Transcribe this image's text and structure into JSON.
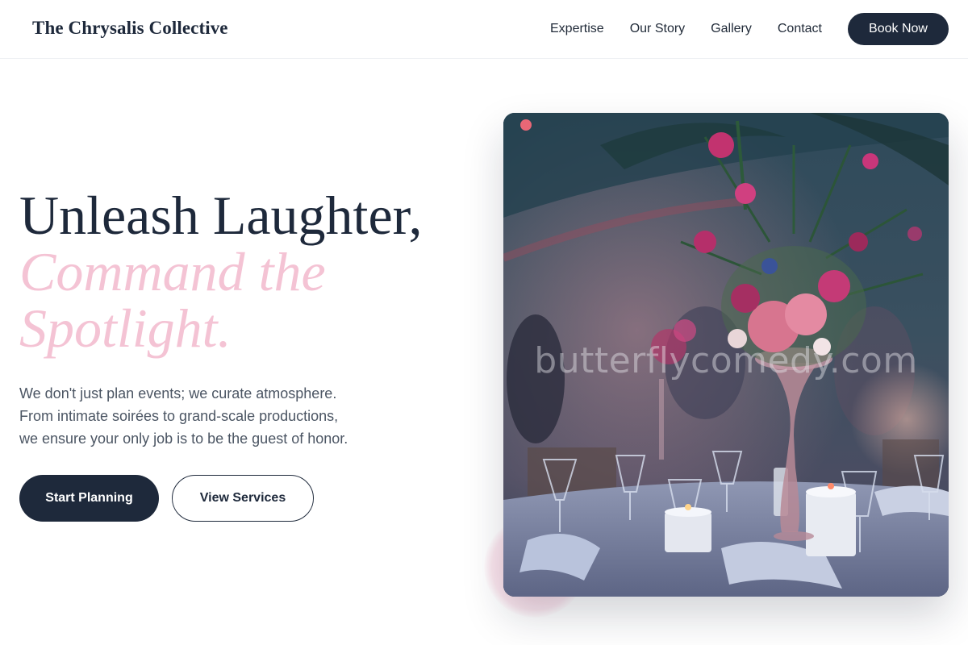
{
  "brand": {
    "name": "The Chrysalis Collective"
  },
  "nav": {
    "links": [
      "Expertise",
      "Our Story",
      "Gallery",
      "Contact"
    ],
    "cta": "Book Now"
  },
  "hero": {
    "title_line1": "Unleash Laughter,",
    "title_accent_line1": "Command the",
    "title_accent_line2": "Spotlight.",
    "description_lines": [
      "We don't just plan events; we curate atmosphere.",
      "From intimate soirées to grand-scale productions,",
      "we ensure your only job is to be the guest of honor."
    ],
    "primary_button": "Start Planning",
    "secondary_button": "View Services"
  },
  "image": {
    "watermark": "butterflycomedy.com"
  },
  "colors": {
    "navy": "#1e293b",
    "accent_pink": "#f4c3d4",
    "body_text": "#4b5563"
  }
}
